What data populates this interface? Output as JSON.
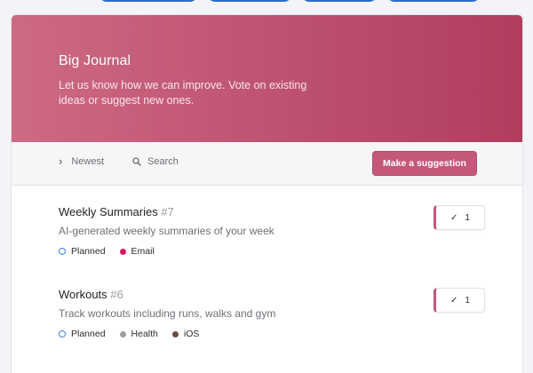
{
  "colors": {
    "accent": "#c5587a",
    "hero_gradient_start": "#cd6a83",
    "hero_gradient_end": "#b23d5e",
    "planned": "#3e7fd6",
    "email": "#d81b60",
    "health": "#9e9e9e",
    "ios": "#6d4c41"
  },
  "hero": {
    "title": "Big Journal",
    "subtitle": "Let us know how we can improve. Vote on existing ideas or suggest new ones."
  },
  "toolbar": {
    "sort_icon": "chevron-right-icon",
    "sort_label": "Newest",
    "search_icon": "search-icon",
    "search_label": "Search",
    "suggest_label": "Make a suggestion"
  },
  "posts": [
    {
      "title": "Weekly Summaries",
      "number": "#7",
      "description": "AI-generated weekly summaries of your week",
      "votes": "1",
      "tags": [
        {
          "label": "Planned",
          "color": "#3e7fd6",
          "style": "ring"
        },
        {
          "label": "Email",
          "color": "#d81b60",
          "style": "fill"
        }
      ]
    },
    {
      "title": "Workouts",
      "number": "#6",
      "description": "Track workouts including runs, walks and gym",
      "votes": "1",
      "tags": [
        {
          "label": "Planned",
          "color": "#3e7fd6",
          "style": "ring"
        },
        {
          "label": "Health",
          "color": "#9e9e9e",
          "style": "fill"
        },
        {
          "label": "iOS",
          "color": "#6d4c41",
          "style": "fill"
        }
      ]
    }
  ]
}
